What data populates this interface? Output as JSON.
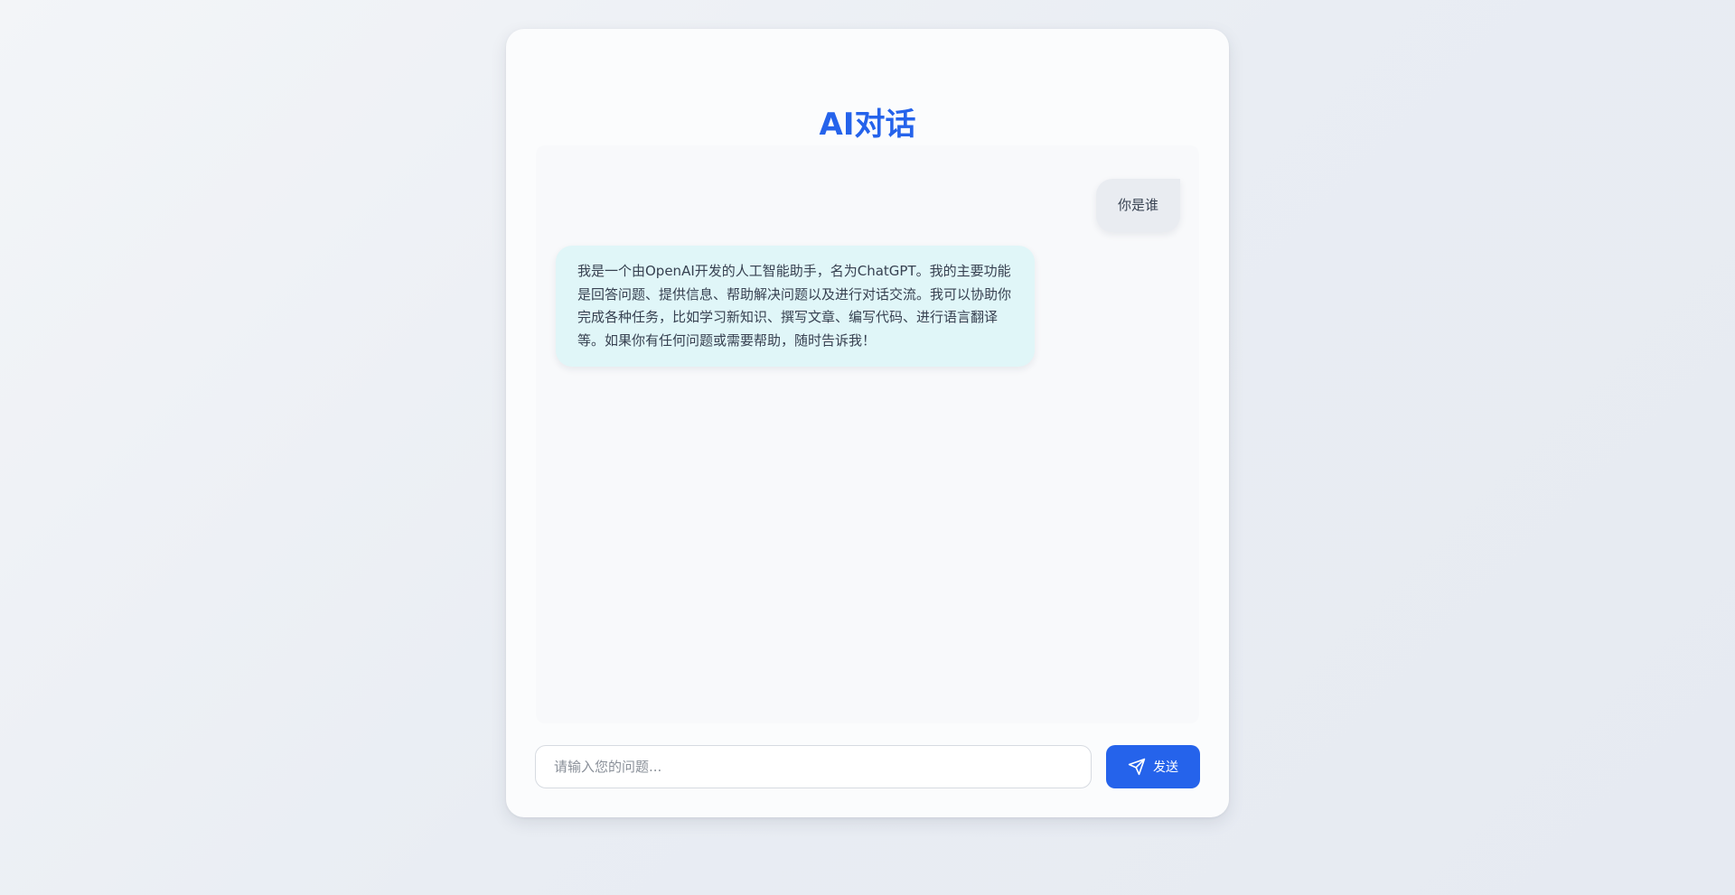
{
  "app": {
    "title": "AI对话"
  },
  "messages": [
    {
      "role": "user",
      "text": "你是谁"
    },
    {
      "role": "assistant",
      "text": "我是一个由OpenAI开发的人工智能助手，名为ChatGPT。我的主要功能是回答问题、提供信息、帮助解决问题以及进行对话交流。我可以协助你完成各种任务，比如学习新知识、撰写文章、编写代码、进行语言翻译等。如果你有任何问题或需要帮助，随时告诉我！"
    }
  ],
  "composer": {
    "placeholder": "请输入您的问题...",
    "value": "",
    "send_label": "发送",
    "send_icon": "send-icon"
  },
  "colors": {
    "accent": "#2563eb",
    "user_bubble": "#e9ecf1",
    "assistant_bubble": "#e0f6f8"
  }
}
